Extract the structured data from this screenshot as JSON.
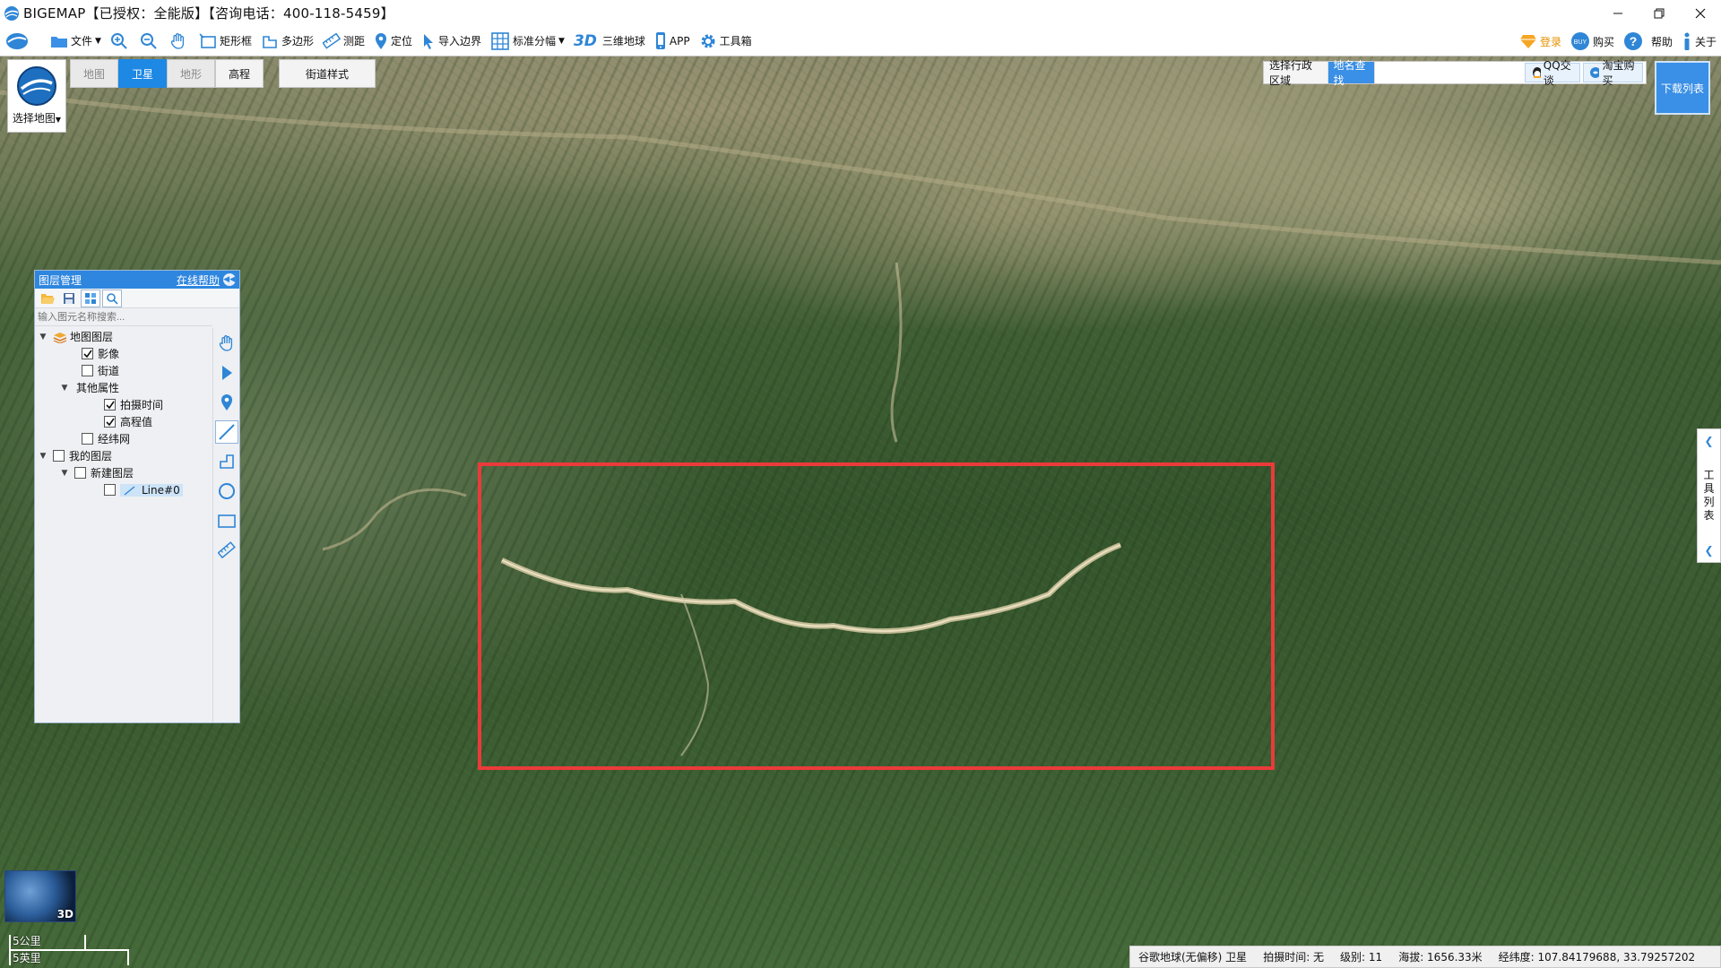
{
  "window": {
    "title": "BIGEMAP【已授权：全能版】【咨询电话：400-118-5459】"
  },
  "toolbar": {
    "file": "文件",
    "rect_select": "矩形框",
    "polygon": "多边形",
    "measure": "测距",
    "locate": "定位",
    "import_boundary": "导入边界",
    "standard_sheet": "标准分幅",
    "globe_3d_mark": "3D",
    "globe_3d": "三维地球",
    "app": "APP",
    "toolbox": "工具箱",
    "login": "登录",
    "buy": "购买",
    "help": "帮助",
    "about": "关于"
  },
  "map_tabs": {
    "select_map": "选择地图",
    "tabs": [
      {
        "label": "地图",
        "state": "disabled"
      },
      {
        "label": "卫星",
        "state": "active"
      },
      {
        "label": "地形",
        "state": "disabled"
      },
      {
        "label": "高程",
        "state": "enabled"
      }
    ],
    "street_style": "街道样式"
  },
  "search": {
    "tab_region": "选择行政区域",
    "tab_place": "地名查找",
    "input_value": "",
    "qq": "QQ交谈",
    "taobao": "淘宝购买",
    "download_list": "下载列表"
  },
  "layer_panel": {
    "title": "图层管理",
    "online_help": "在线帮助",
    "search_placeholder": "输入图元名称搜索...",
    "tree": {
      "map_layers": "地图图层",
      "imagery": "影像",
      "streets": "街道",
      "other_attrs": "其他属性",
      "capture_time": "拍摄时间",
      "elevation": "高程值",
      "graticule": "经纬网",
      "my_layers": "我的图层",
      "new_layer": "新建图层",
      "line": "Line#0"
    }
  },
  "side_tab": {
    "label_chars": [
      "工",
      "具",
      "列",
      "表"
    ]
  },
  "mini_globe": {
    "label": "3D"
  },
  "scale": {
    "km": "5公里",
    "mi": "5英里"
  },
  "status": {
    "source": "谷歌地球(无偏移) 卫星",
    "capture_time": "拍摄时间: 无",
    "level": "级别:  11",
    "altitude": "海拔: 1656.33米",
    "lonlat": "经纬度:  107.84179688, 33.79257202"
  },
  "colors": {
    "accent": "#1e88e5",
    "selection": "#ec3a3a"
  }
}
